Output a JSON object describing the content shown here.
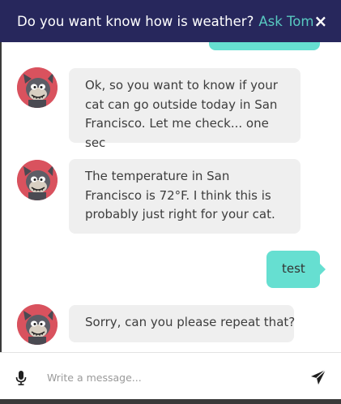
{
  "header": {
    "title": "Do you want know how is weather?",
    "link_label": "Ask Tom",
    "close_label": "×",
    "background_color": "#27275c",
    "link_color": "#58c9c0"
  },
  "messages": [
    {
      "sender": "bot",
      "avatar_icon": "cat-avatar-icon",
      "text": "Ok, so you want to know if your cat can go outside today in San Francisco. Let me check... one sec"
    },
    {
      "sender": "bot",
      "avatar_icon": "cat-avatar-icon",
      "text": "The temperature in San Francisco is 72°F. I think this is probably just right for your cat."
    },
    {
      "sender": "user",
      "text": "test"
    },
    {
      "sender": "bot",
      "avatar_icon": "cat-avatar-icon",
      "text": "Sorry, can you please repeat that?"
    }
  ],
  "composer": {
    "placeholder": "Write a message...",
    "mic_icon": "microphone-icon",
    "send_icon": "send-icon"
  },
  "colors": {
    "user_bubble": "#66dfd1",
    "bot_bubble": "#efefef",
    "avatar_bg": "#d9525e"
  }
}
